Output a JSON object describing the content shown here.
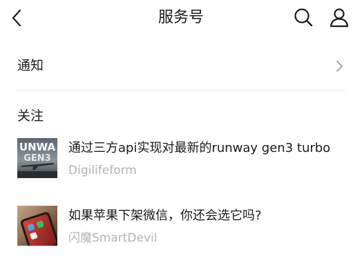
{
  "header": {
    "title": "服务号",
    "back_icon": "back-chevron-icon",
    "search_icon": "search-icon",
    "profile_icon": "user-icon"
  },
  "notifications": {
    "label": "通知",
    "chevron_icon": "chevron-right-icon"
  },
  "following": {
    "section_title": "关注",
    "articles": [
      {
        "title": "通过三方api实现对最新的runway gen3 turbo",
        "source": "Digilifeform",
        "thumbnail_text": [
          "UNWA",
          "GEN3"
        ]
      },
      {
        "title": "如果苹果下架微信，你还会选它吗?",
        "source": "闪魔SmartDevil"
      }
    ]
  },
  "colors": {
    "text_primary": "#1a1a1a",
    "text_secondary": "#b3b3b3",
    "divider": "#e8e8e8",
    "background": "#ffffff"
  }
}
